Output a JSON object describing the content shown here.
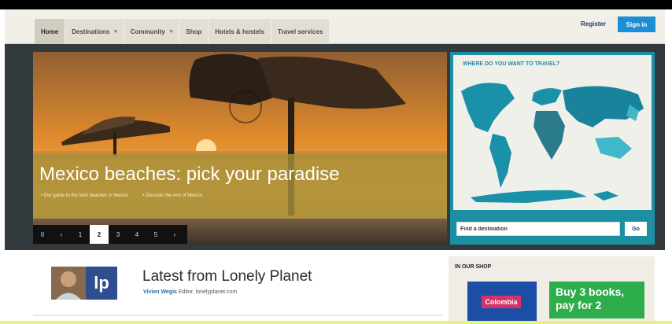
{
  "nav": {
    "tabs": [
      {
        "label": "Home",
        "caret": ""
      },
      {
        "label": "Destinations",
        "caret": "▾"
      },
      {
        "label": "Community",
        "caret": "▾"
      },
      {
        "label": "Shop",
        "caret": ""
      },
      {
        "label": "Hotels & hostels",
        "caret": ""
      },
      {
        "label": "Travel services",
        "caret": ""
      }
    ],
    "register": "Register",
    "sign_in": "Sign in"
  },
  "hero": {
    "headline": "Mexico beaches: pick your paradise",
    "link_1": "• Our guide to the best beaches in Mexico",
    "link_2": "• Discover the rest of Mexico",
    "pager": [
      "II",
      "‹",
      "1",
      "2",
      "3",
      "4",
      "5",
      "›"
    ],
    "active_page": "2"
  },
  "map": {
    "title": "WHERE DO YOU WANT TO TRAVEL?",
    "search_value": "Find a destination",
    "go": "Go"
  },
  "latest": {
    "title": "Latest from Lonely Planet",
    "author": "Vivien Wegis",
    "role": "Editor, lonelyplanet.com",
    "logo": "lp"
  },
  "shop": {
    "title": "IN OUR SHOP",
    "book_label": "Colombia",
    "promo_line1": "Buy 3 books,",
    "promo_line2": "pay for 2"
  },
  "colors": {
    "accent": "#1a8ed6",
    "map": "#1d8fa3",
    "promo": "#2eae4b"
  }
}
